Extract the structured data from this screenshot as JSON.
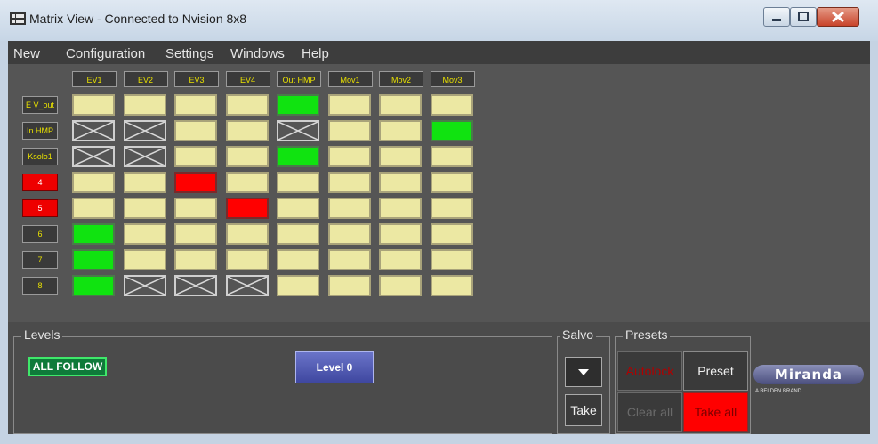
{
  "window": {
    "title": "Matrix View - Connected to Nvision 8x8"
  },
  "menu": [
    "New",
    "Configuration",
    "Settings",
    "Windows",
    "Help"
  ],
  "columns": [
    "EV1",
    "EV2",
    "EV3",
    "EV4",
    "Out HMP",
    "Mov1",
    "Mov2",
    "Mov3"
  ],
  "rows": [
    {
      "label": "E V_out",
      "color": "dark",
      "cells": [
        "y",
        "y",
        "y",
        "y",
        "g",
        "y",
        "y",
        "y"
      ]
    },
    {
      "label": "In HMP",
      "color": "dark",
      "cells": [
        "x",
        "x",
        "y",
        "y",
        "x",
        "y",
        "y",
        "g"
      ]
    },
    {
      "label": "Ksolo1",
      "color": "dark",
      "cells": [
        "x",
        "x",
        "y",
        "y",
        "g",
        "y",
        "y",
        "y"
      ]
    },
    {
      "label": "4",
      "color": "red",
      "cells": [
        "y",
        "y",
        "r",
        "y",
        "y",
        "y",
        "y",
        "y"
      ]
    },
    {
      "label": "5",
      "color": "red",
      "cells": [
        "y",
        "y",
        "y",
        "r",
        "y",
        "y",
        "y",
        "y"
      ]
    },
    {
      "label": "6",
      "color": "dark",
      "cells": [
        "g",
        "y",
        "y",
        "y",
        "y",
        "y",
        "y",
        "y"
      ]
    },
    {
      "label": "7",
      "color": "dark",
      "cells": [
        "g",
        "y",
        "y",
        "y",
        "y",
        "y",
        "y",
        "y"
      ]
    },
    {
      "label": "8",
      "color": "dark",
      "cells": [
        "g",
        "x",
        "x",
        "x",
        "y",
        "y",
        "y",
        "y"
      ]
    }
  ],
  "levels": {
    "title": "Levels",
    "all_follow": "ALL FOLLOW",
    "level0": "Level 0"
  },
  "salvo": {
    "title": "Salvo",
    "take": "Take"
  },
  "presets": {
    "title": "Presets",
    "autolock": "Autolock",
    "preset": "Preset",
    "clear_all": "Clear all",
    "take_all": "Take all"
  },
  "logo": {
    "name": "Miranda",
    "tagline": "A BELDEN BRAND"
  },
  "colors": {
    "yellow": "#ece8a3",
    "green": "#10e310",
    "red": "#ff0000"
  }
}
